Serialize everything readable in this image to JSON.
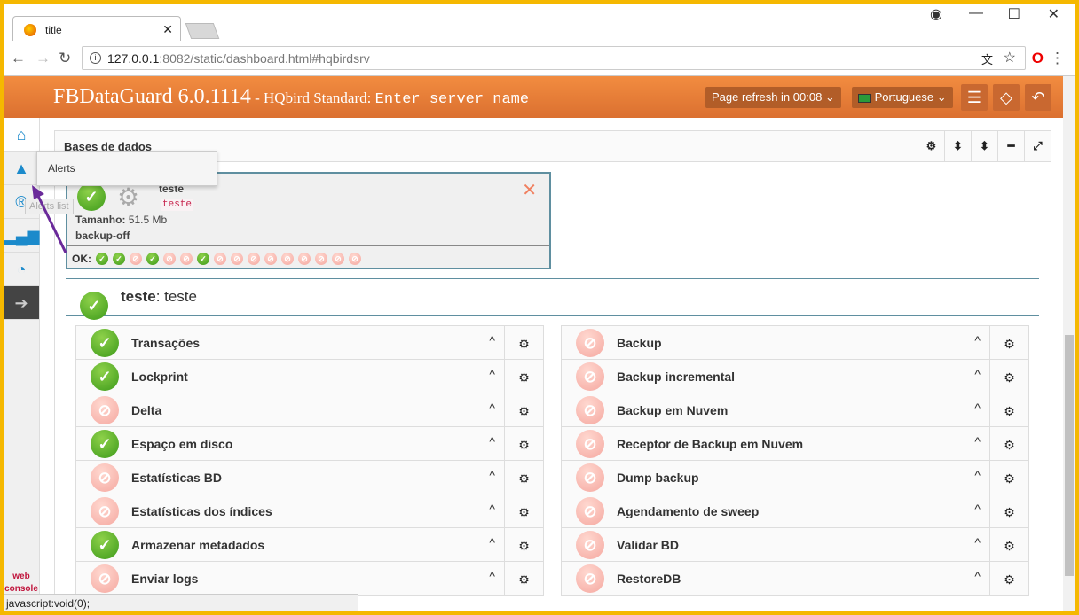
{
  "browser": {
    "tab_title": "title",
    "url_host": "127.0.0.1",
    "url_rest": ":8082/static/dashboard.html#hqbirdsrv",
    "status_text": "javascript:void(0);"
  },
  "header": {
    "app": "FBDataGuard 6.0.1114",
    "edition": " - HQbird Standard: ",
    "server": "Enter server name",
    "refresh": "Page refresh in 00:08",
    "language": "Portuguese"
  },
  "sidebar": {
    "tooltip": "Alerts",
    "tooltip2": "Alerts list",
    "web_console": [
      "web",
      "console"
    ]
  },
  "panel": {
    "title": "Bases de dados"
  },
  "db_card": {
    "name": "teste",
    "alias": "teste",
    "size_label": "Tamanho:",
    "size": "51.5 Mb",
    "backup": "backup-off",
    "ok_label": "OK:",
    "statuses": [
      "ok",
      "ok",
      "off",
      "ok",
      "off",
      "off",
      "ok",
      "off",
      "off",
      "off",
      "off",
      "off",
      "off",
      "off",
      "off",
      "off"
    ]
  },
  "section": {
    "name": "teste",
    "alias": ": teste"
  },
  "left_items": [
    {
      "label": "Transações",
      "status": "ok"
    },
    {
      "label": "Lockprint",
      "status": "ok"
    },
    {
      "label": "Delta",
      "status": "off"
    },
    {
      "label": "Espaço em disco",
      "status": "ok"
    },
    {
      "label": "Estatísticas BD",
      "status": "off"
    },
    {
      "label": "Estatísticas dos índices",
      "status": "off"
    },
    {
      "label": "Armazenar metadados",
      "status": "ok"
    },
    {
      "label": "Enviar logs",
      "status": "off"
    }
  ],
  "right_items": [
    {
      "label": "Backup",
      "status": "off"
    },
    {
      "label": "Backup incremental",
      "status": "off"
    },
    {
      "label": "Backup em Nuvem",
      "status": "off"
    },
    {
      "label": "Receptor de Backup em Nuvem",
      "status": "off"
    },
    {
      "label": "Dump backup",
      "status": "off"
    },
    {
      "label": "Agendamento de sweep",
      "status": "off"
    },
    {
      "label": "Validar BD",
      "status": "off"
    },
    {
      "label": "RestoreDB",
      "status": "off"
    }
  ],
  "colors": {
    "header": "#e57e36",
    "ok": "#4caa22",
    "off": "#f5a8a0"
  }
}
